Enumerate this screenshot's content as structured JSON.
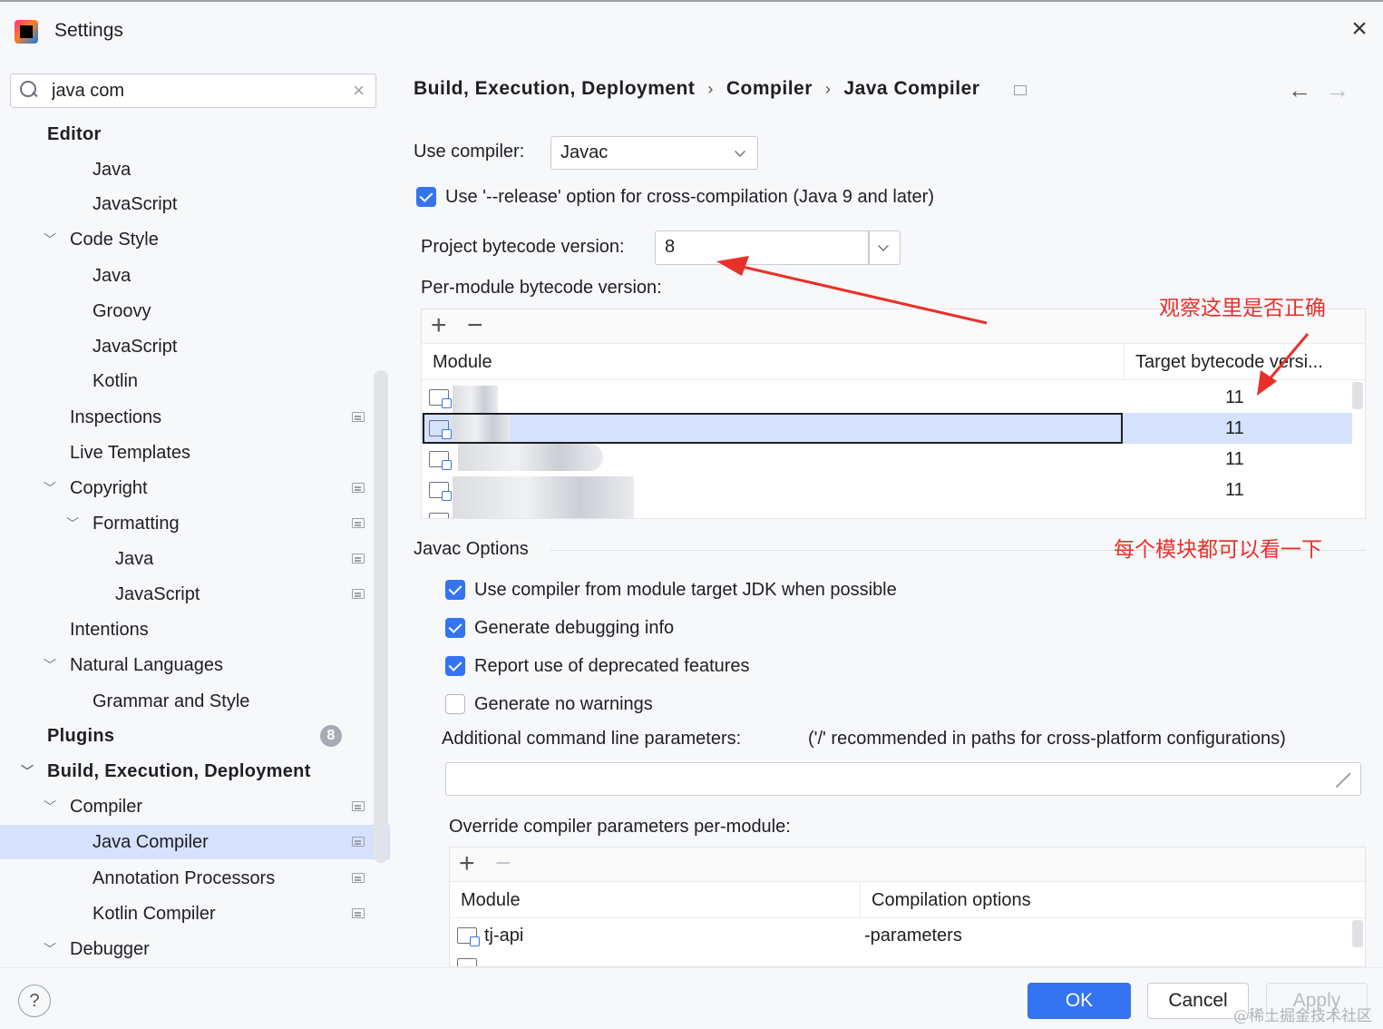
{
  "window": {
    "title": "Settings"
  },
  "search": {
    "value": "java com"
  },
  "sidebar": {
    "items": [
      {
        "label": "Editor"
      },
      {
        "label": "Java"
      },
      {
        "label": "JavaScript"
      },
      {
        "label": "Code Style"
      },
      {
        "label": "Java"
      },
      {
        "label": "Groovy"
      },
      {
        "label": "JavaScript"
      },
      {
        "label": "Kotlin"
      },
      {
        "label": "Inspections"
      },
      {
        "label": "Live Templates"
      },
      {
        "label": "Copyright"
      },
      {
        "label": "Formatting"
      },
      {
        "label": "Java"
      },
      {
        "label": "JavaScript"
      },
      {
        "label": "Intentions"
      },
      {
        "label": "Natural Languages"
      },
      {
        "label": "Grammar and Style"
      },
      {
        "label": "Plugins",
        "badge": "8"
      },
      {
        "label": "Build, Execution, Deployment"
      },
      {
        "label": "Compiler"
      },
      {
        "label": "Java Compiler",
        "selected": true
      },
      {
        "label": "Annotation Processors"
      },
      {
        "label": "Kotlin Compiler"
      },
      {
        "label": "Debugger"
      }
    ]
  },
  "breadcrumb": [
    "Build, Execution, Deployment",
    "Compiler",
    "Java Compiler"
  ],
  "compiler": {
    "use_compiler_label": "Use compiler:",
    "use_compiler_value": "Javac",
    "release_option_label": "Use '--release' option for cross-compilation (Java 9 and later)",
    "release_option_checked": true,
    "project_bytecode_label": "Project bytecode version:",
    "project_bytecode_value": "8",
    "per_module_label": "Per-module bytecode version:",
    "module_table": {
      "columns": [
        "Module",
        "Target bytecode versi..."
      ],
      "rows": [
        {
          "target": "11"
        },
        {
          "target": "11",
          "selected": true
        },
        {
          "target": "11"
        },
        {
          "target": "11"
        }
      ]
    }
  },
  "javac": {
    "section_title": "Javac Options",
    "options": [
      {
        "label": "Use compiler from module target JDK when possible",
        "checked": true
      },
      {
        "label": "Generate debugging info",
        "checked": true
      },
      {
        "label": "Report use of deprecated features",
        "checked": true
      },
      {
        "label": "Generate no warnings",
        "checked": false
      }
    ],
    "additional_params_label": "Additional command line parameters:",
    "additional_params_hint": "('/' recommended in paths for cross-platform configurations)",
    "additional_params_value": "",
    "override_label": "Override compiler parameters per-module:",
    "override_table": {
      "columns": [
        "Module",
        "Compilation options"
      ],
      "rows": [
        {
          "module": "tj-api",
          "options": "-parameters"
        }
      ]
    }
  },
  "annotations": {
    "check_here": "观察这里是否正确",
    "check_each": "每个模块都可以看一下",
    "color": "#e8302a"
  },
  "buttons": {
    "ok": "OK",
    "cancel": "Cancel",
    "apply": "Apply",
    "help": "?"
  },
  "watermark": "@稀土掘金技术社区",
  "colors": {
    "accent": "#3574f0",
    "selection": "#d5e1fd"
  }
}
